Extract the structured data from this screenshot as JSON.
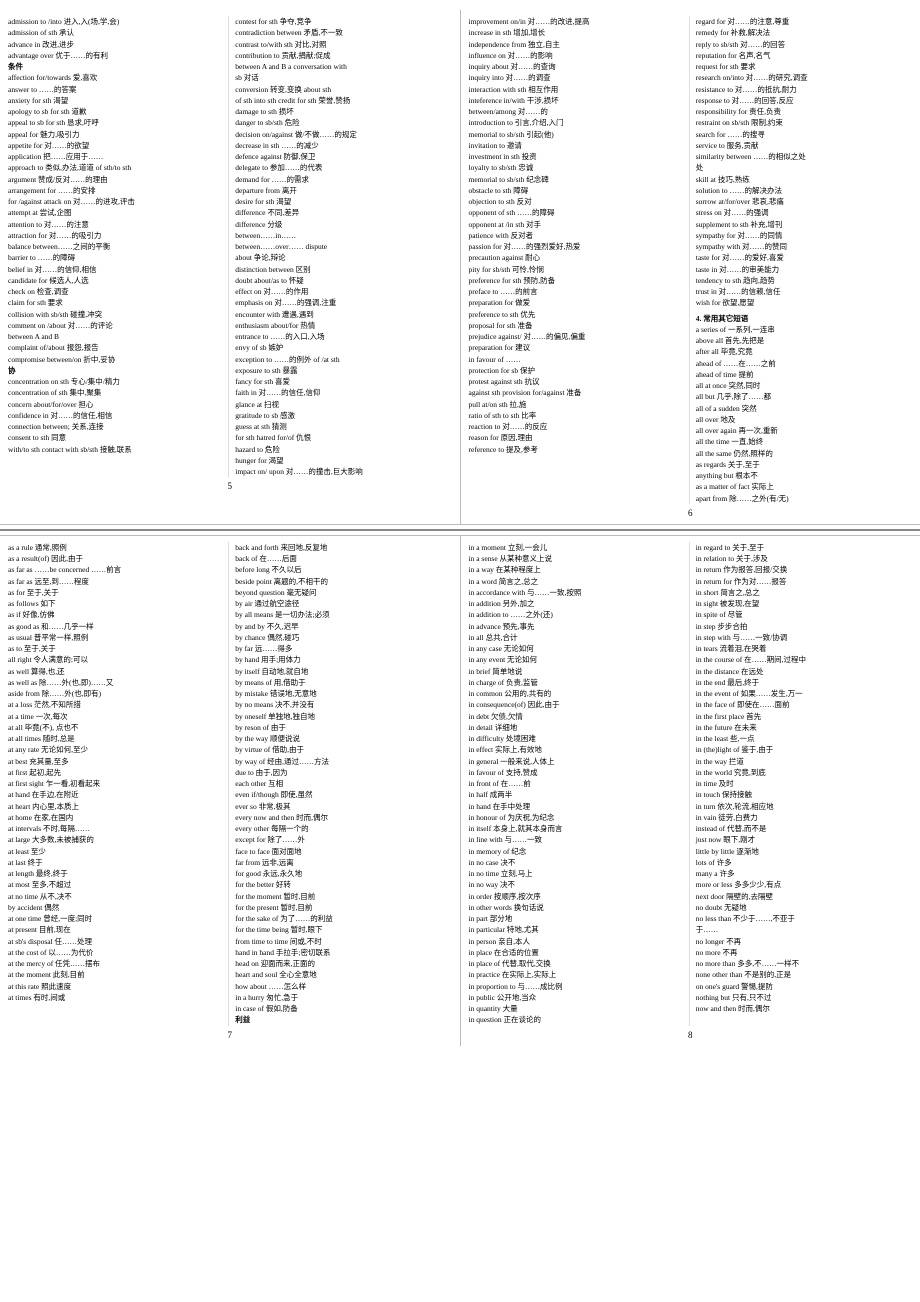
{
  "pages": {
    "top": {
      "left_col1": {
        "entries": [
          "admission to /into 进入,入(场,学,会)",
          "admission of sth 承认",
          "advance in 改进,进步",
          "advantage over 优于……的有利",
          "条件",
          "affection for/towards 爱,喜欢",
          "answer to ……的答案",
          "anxiety for sth 渴望",
          "apology to sb for sth 道歉",
          "appeal to sb for sth 恳求,吁呼",
          "appeal for 魅力,吸引力",
          "appetite for 对……的欲望",
          "application 把……应用于……",
          "approach to 类似,办法,道道 of sth/to sth",
          "argument 赞成/反对……的理由",
          "arrangement for ……的安排",
          "for /against attack on 对……的进攻,评击",
          "attempt at 尝试,企图",
          "attention to 对……的注意",
          "attraction for 对……的吸引力",
          "balance between……之间的平衡",
          "barrier to ……的障碍",
          "belief in 对……的信仰,相信",
          "candidate for 候选人,人选",
          "check on 检查,调查",
          "claim for sth 要求",
          "collision with sb/sth 碰撞,冲突",
          "comment on /about 对……的评论",
          "between A and B",
          "complaint of/about 报怨,报告",
          "compromise between/on 折中,妥协",
          "协",
          "concentration on sth 专心/集中/精力",
          "concentration of sth 集中,聚集",
          "concern about/for/over 担心",
          "confidence in 对……的信任,相信",
          "connection between; 关系,连接",
          "consent to sth 同意",
          "with/to sth contact with sb/sth 接触,联系"
        ]
      },
      "left_col2": {
        "entries": [
          "contest for sth 争夺,竞争",
          "contradiction between 矛盾,不一致",
          "contrast to/with sth 对比,对照",
          "contribution to 贡献,捐献;促成",
          "between A and B a conversation with",
          "sb 对话",
          "conversion 转变,变换 about sth",
          "of sth into sth credit for sth 荣誉,赞扬",
          "damage to sth 损坏",
          "danger to sb/sth 危险",
          "decision on/against 做/不做……的规定",
          "decrease in sth ……的减少",
          "defence against 防御,保卫",
          "delegate to 参加……的代表",
          "demand for ……的需求",
          "departure from 离开",
          "desire for sth 渴望",
          "difference 不同,差异",
          "difference 分级",
          "between……in……",
          "between……over…… dispute",
          "about 争论,辩论",
          "distinction between 区别",
          "doubt about/as to 怀疑",
          "effect on 对……的作用",
          "emphasis on 对……的强调,注重",
          "encounter with 遭遇,遇到",
          "enthusiasm about/for 热情",
          "entrance to ……的入口,入场",
          "envy of sb 嫉妒",
          "exception to ……的例外 of /at sth",
          "exposure to sth 暴露",
          "fancy for sth 喜爱",
          "faith in 对……的信任,信仰",
          "glance at 扫视",
          "gratitude to sb 感激",
          "guess at sth 猜测",
          "for sth hatred for/of 仇恨",
          "hazard to 危险",
          "hunger for 渴望",
          "impact on/ upon 对……的撞击,巨大影响"
        ]
      },
      "right_col1": {
        "entries": [
          "improvement on/in 对……的改进,提高",
          "increase in sth 增加,增长",
          "independence from 独立,自主",
          "influence on 对……的影响",
          "inquiry about 对……的查询",
          "inquiry into 对……的调查",
          "interaction with sth 相互作用",
          "inteference in/with 干涉,损坏",
          "between/among 对……的",
          "introduction to 引言,介绍,入门",
          "memorial to sb/sth 引起(他)",
          "invitation to 邀请",
          "investment in sth 投资",
          "loyalty to sb/sth 忠诚",
          "memorial to sb/sth 纪念碑",
          "obstacle to sth 障碍",
          "objection to sth 反对",
          "opponent of sth ……的障碍",
          "opponent at /in sth 对手",
          "patience with 反对者",
          "passion for 对……的强烈爱好,热爱",
          "precaution against 耐心",
          "pity for sb/sth 可怜,怜悯",
          "preference for sth 预防,防备",
          "preface to ……的前言",
          "preparation for 做爱",
          "preference to sth 优先",
          "proposal for sth 准备",
          "prejudice against/ 对……的偏见,偏重",
          "preparation for 建议",
          "in favour of ……",
          "protection for sb 保护",
          "protest against sth 抗议",
          "against sth provision for/against 准备",
          "pull at/on sth 拉,施",
          "ratio of sth to sth 比率",
          "reaction to 对……的反应",
          "reason for 原因,理由",
          "reference to 提及,参考"
        ]
      },
      "right_col2": {
        "entries": [
          "regard for 对……的注意,尊重",
          "remedy for 补救,解决法",
          "reply to sb/sth 对……的回答",
          "reputation for 名声,名气",
          "request for sth 要求",
          "research on/into 对……的研究,调查",
          "resistance to 对……的抵抗,耐力",
          "response to 对……的回答,反应",
          "responsibility for 责任,负责",
          "restraint on sb/sth 限制,约束",
          "search for ……的搜寻",
          "service to 服务,贡献",
          "similarity between ……的相似之处",
          "处",
          "skill at 技巧,熟练",
          "solution to ……的解决办法",
          "sorrow at/for/over 悲哀,悲痛",
          "stress on 对……的强调",
          "supplement to sth 补充,增刊",
          "sympathy for 对……的同情",
          "sympathy with 对……的赞同",
          "taste for 对……的爱好,喜爱",
          "taste in 对……的审美能力",
          "tendency to sth 趋向,趋势",
          "trust in 对……的信赖,信任",
          "wish for 欲望,愿望",
          "4. 常用其它短语",
          "a series of 一系列,一连串",
          "above all 首先,先把是",
          "after all 毕竟,究竟",
          "ahead of ……在……之前",
          "ahead of time 提前",
          "all at once 突然,同时",
          "all but 几乎,除了……都",
          "all of a sudden 突然",
          "all over 地及",
          "all over again 再一次,重新",
          "all the time 一直,始终",
          "all the same 仍然,照样的",
          "as regards 关于,至于",
          "anything but 根本不",
          "as a matter of fact 实际上",
          "apart from 除……之外(有/无)"
        ]
      }
    },
    "top_page_nums": [
      "5",
      "6"
    ],
    "bottom": {
      "col1": {
        "entries": [
          "as a rule 通常,照例",
          "as a result(of) 因此,由于",
          "as far as ……be concerned ……前言",
          "as far as 远至,到……程度",
          "as for 至于,关于",
          "as follows 如下",
          "as if 好像,仿佛",
          "as good as 和……几乎一样",
          "as usual 普平常一样,照例",
          "as to 至于,关于",
          "all right 令人满意的;可以",
          "as well 算得,也,还",
          "as well as 除……外(也,即)……又",
          "aside from 除……外(也,即有)",
          "at a loss 茫然,不知所措",
          "at a time 一次,每次",
          "at all 毕竟(不), 点也不",
          "at all times 随时,总是",
          "at any rate 无论如何,至少",
          "at best 充其量,至多",
          "at first 起初,起先",
          "at first sight 乍一看,初看起来",
          "at hand 在手边,在附近",
          "at heart 内心里,本质上",
          "at home 在家,在国内",
          "at intervals 不时,每隔……",
          "at large 大多数,未被捕获的",
          "at least 至少",
          "at last 终于",
          "at length 最终,终于",
          "at most 至多,不超过",
          "at no time 从不,决不",
          "by accident 偶然",
          "at one time 曾经,一度;同时",
          "at present 目前,现在",
          "at sb's disposal 任……处理",
          "at the cost of 以……为代价",
          "at the mercy of 任凭……摆布",
          "at the moment 此刻,目前",
          "at this rate 照此速度",
          "at times 有时,间或"
        ]
      },
      "col2": {
        "entries": [
          "back and forth 来回地,反复地",
          "back of 在……后面",
          "before long 不久以后",
          "beside point 离题的,不相干的",
          "beyond question 毫无疑问",
          "by air 通过航空途径",
          "by all means 是一切办法;必须",
          "by and by 不久,迟早",
          "by chance 偶然,碰巧",
          "by far 远……得多",
          "by hand 用手;用体力",
          "by itself 自动地,就自地",
          "by means of 用,借助于",
          "by mistake 错误地,无意地",
          "by no means 决不,并没有",
          "by oneself 单独地,独自地",
          "by reson of 由于",
          "by the way 顺便说说",
          "by virtue of 借助,由于",
          "by way of 经由,通过……方法",
          "due to 由于,因为",
          "each other 互相",
          "even if/though 即使,虽然",
          "ever so 非常,极其",
          "every now and then 时而,偶尔",
          "every other 每隔一个的",
          "except for 除了……外",
          "face to face 面对面地",
          "far from 远非,远离",
          "for good 永远,永久地",
          "for the better 好转",
          "for the moment 暂时,目前",
          "for the present 暂时,目前",
          "for the sake of 为了……的",
          "利益",
          "for the time being 暂时,眼下",
          "from time to time 间或,不时",
          "hand in hand 手拉手;密切联系",
          "head on 迎面而来,正面的",
          "heart and soul 全心全意地",
          "how about ……怎么样",
          "in a hurry 匆忙,急于",
          "in case of 假如,防备"
        ]
      },
      "col3": {
        "entries": [
          "in a moment 立刻,一会儿",
          "in a sense 从某种意义上说",
          "in a way 在某种程度上",
          "in a word 简言之,总之",
          "in accordance with 与……一致,按照",
          "in addition 另外,加之",
          "in addition to ……之外(还)",
          "in advance 预先,事先",
          "in all 总共,合计",
          "in any case 无论如何",
          "in any event 无论如何",
          "in brief 简单地说",
          "in charge of 负责,监管",
          "in common 公用的,共有的",
          "in consequence(of) 因此,由于",
          "in debt 欠债,欠情",
          "in detail 详细地",
          "in difficulty 处境困难",
          "in effect 实际上,有效地",
          "in general 一般来说,人体上",
          "in favour of 支持,赞成",
          "in front of 在……前",
          "in half 成两半",
          "in hand 在手中处理",
          "in honour of 为庆祝,为纪念",
          "in itself 本身上,就其本身而言",
          "in line with 与……一致",
          "in memory of 纪念",
          "in no case 决不",
          "in no time 立刻,马上",
          "in no way 决不",
          "in order 按顺序,按次序",
          "in other words 换句话说",
          "in part 部分地",
          "in particular 特地,尤其",
          "in person 亲自,本人",
          "in place 在合适的位置",
          "in place of 代替,取代,交换",
          "in practice 在实际上,实际上",
          "in proportion to 与……成比例",
          "in public 公开地,当众",
          "in quantity 大量",
          "in question 正在谈论的"
        ]
      },
      "col4": {
        "entries": [
          "in regard to 关于,至于",
          "in relation to 关于,涉及",
          "in return 作为报答,回报/交换",
          "in return for 作为对……报答",
          "in short 简言之,总之",
          "in sight 被发现,在望",
          "in spite of 尽管",
          "in step 步步合拍",
          "in step with 与……一致/协调",
          "in tears 流着泪,在哭着",
          "in the course of 在……期间,过程",
          "中",
          "in the distance 在远处",
          "in the end 最后,终于",
          "in the event of 如果……发生,万一",
          "in the face of 即使在……面前",
          "in the first place 首先",
          "in the future 在未来",
          "in the least 些,一点",
          "in (the)light of 鉴于,由于",
          "in the way 拦道",
          "in the world 究竟,到底",
          "in time 及时",
          "in touch 保持接触",
          "in turn 依次,轮流,相应地",
          "in vain 徒劳,白费力",
          "instead of 代替,而不是",
          "just now 眼下,刚才",
          "little by little 逐渐地",
          "lots of 许多",
          "many a 许多",
          "more or less 多多少少,有点",
          "next door 隔壁的,去隔壁",
          "no doubt 无疑地",
          "no less than 不少于……,不亚于",
          "于……",
          "no longer 不再",
          "no more 不再",
          "no more than 多多,不……一样不",
          "none other than 不是别的,正是",
          "on one's guard 警惕,提防",
          "nothing but 只有,只不过",
          "now and then 时而,偶尔"
        ]
      }
    },
    "bottom_page_nums": [
      "7",
      "8"
    ]
  }
}
